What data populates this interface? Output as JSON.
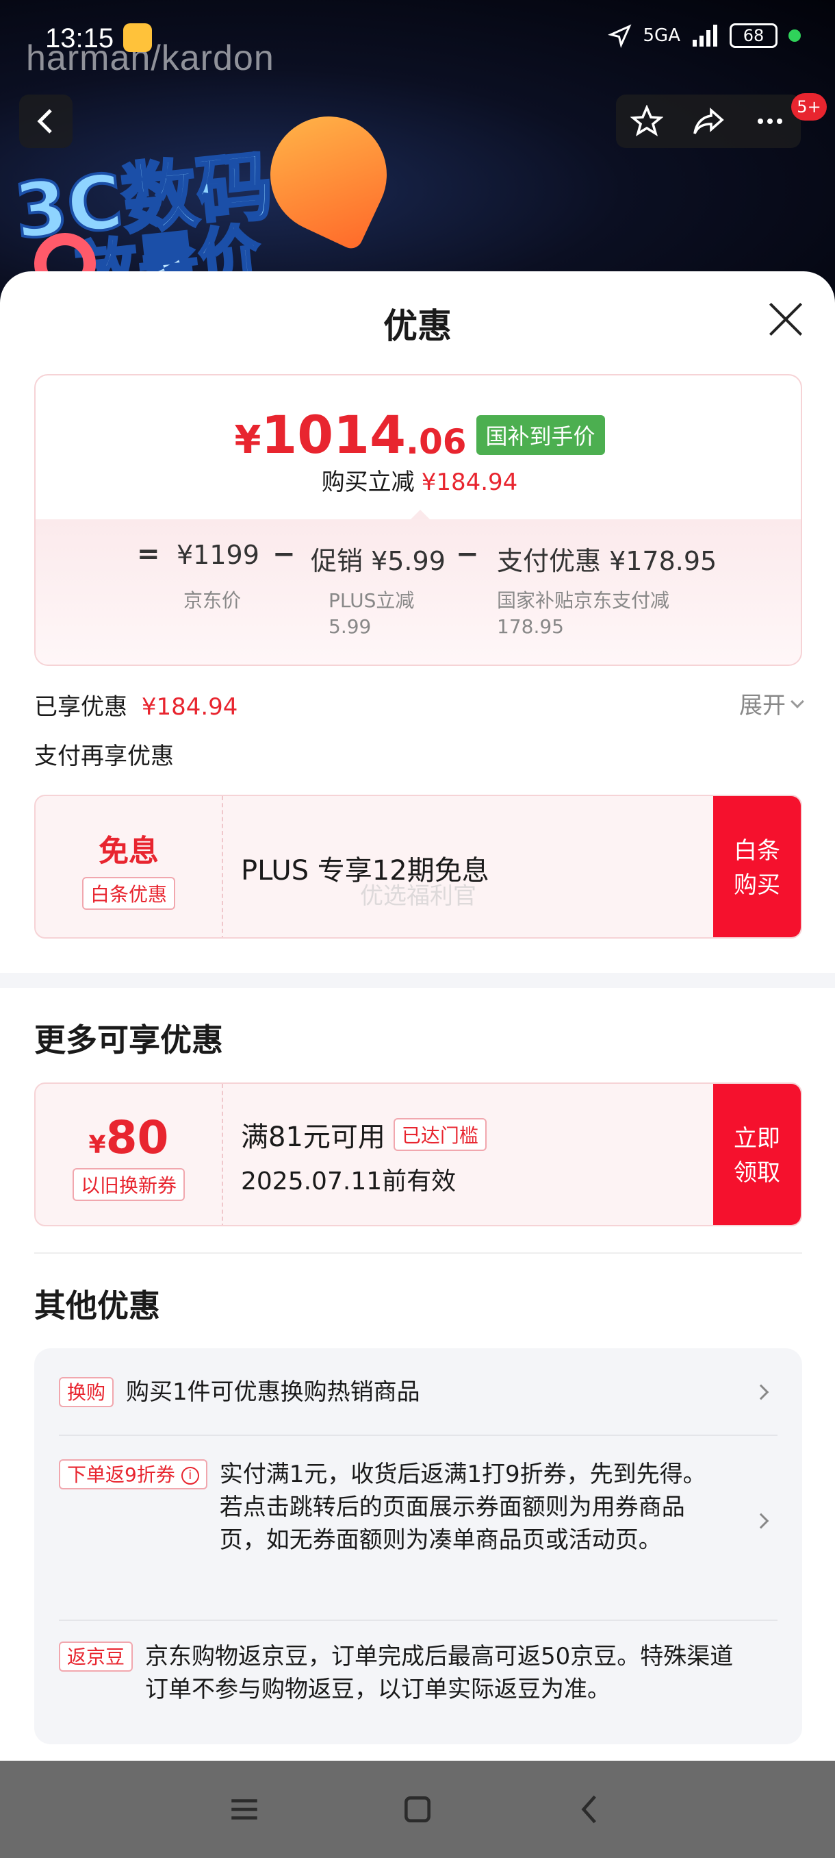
{
  "status_bar": {
    "time": "13:15",
    "network": "5GA",
    "battery": "68"
  },
  "background": {
    "brand": "harman/kardon",
    "promo_line1": "3C数码",
    "promo_line2": "放暑价"
  },
  "header_nav": {
    "badge": "5+"
  },
  "sheet": {
    "title": "优惠",
    "price_card": {
      "currency": "¥",
      "price_int": "1014",
      "price_dec": ".06",
      "price_tag": "国补到手价",
      "discount_label": "购买立减",
      "discount_value": "¥184.94",
      "breakdown": {
        "eq": "=",
        "jd_price": "¥1199",
        "jd_price_label": "京东价",
        "minus1": "−",
        "promo": "促销 ¥5.99",
        "promo_sub1": "PLUS立减",
        "promo_sub2": "5.99",
        "minus2": "−",
        "pay": "支付优惠 ¥178.95",
        "pay_sub1": "国家补贴京东支付减",
        "pay_sub2": "178.95"
      }
    },
    "enjoyed_label": "已享优惠",
    "enjoyed_value": "¥184.94",
    "expand_label": "展开",
    "pay_more_label": "支付再享优惠",
    "baitiao_coupon": {
      "title": "免息",
      "tag": "白条优惠",
      "desc": "PLUS 专享12期免息",
      "watermark": "优选福利官",
      "button": "白条\n购买"
    },
    "more_title": "更多可享优惠",
    "tradein_coupon": {
      "currency": "¥",
      "amount": "80",
      "tag": "以旧换新券",
      "condition": "满81元可用",
      "status_tag": "已达门槛",
      "expiry": "2025.07.11前有效",
      "button": "立即\n领取"
    },
    "other_title": "其他优惠",
    "other_items": [
      {
        "tag": "换购",
        "text": "购买1件可优惠换购热销商品"
      },
      {
        "tag": "下单返9折券",
        "text": "实付满1元，收货后返满1打9折券，先到先得。若点击跳转后的页面展示券面额则为用券商品页，如无券面额则为凑单商品页或活动页。"
      },
      {
        "tag": "返京豆",
        "text": "京东购物返京豆，订单完成后最高可返50京豆。特殊渠道订单不参与购物返豆，以订单实际返豆为准。"
      }
    ]
  },
  "colors": {
    "accent_red": "#e8252f",
    "button_red": "#f5112d",
    "tag_green": "#4caf50"
  }
}
